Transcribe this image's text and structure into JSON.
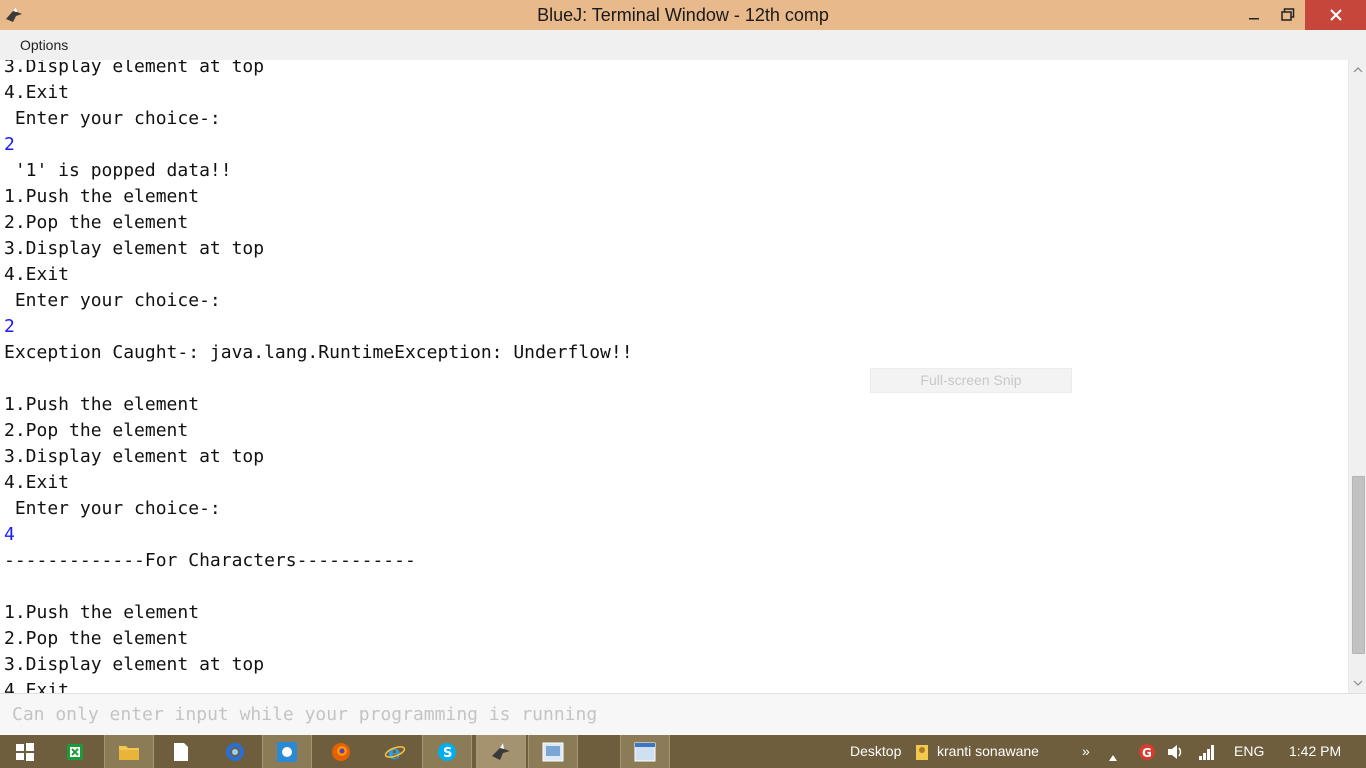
{
  "window": {
    "title": "BlueJ: Terminal Window - 12th comp"
  },
  "menu": {
    "items": [
      "Options"
    ]
  },
  "terminal": {
    "lines": [
      {
        "text": "3.Display element at top",
        "type": "output"
      },
      {
        "text": "4.Exit",
        "type": "output"
      },
      {
        "text": " Enter your choice-:",
        "type": "output"
      },
      {
        "text": "2",
        "type": "input"
      },
      {
        "text": " '1' is popped data!!",
        "type": "output"
      },
      {
        "text": "1.Push the element",
        "type": "output"
      },
      {
        "text": "2.Pop the element",
        "type": "output"
      },
      {
        "text": "3.Display element at top",
        "type": "output"
      },
      {
        "text": "4.Exit",
        "type": "output"
      },
      {
        "text": " Enter your choice-:",
        "type": "output"
      },
      {
        "text": "2",
        "type": "input"
      },
      {
        "text": "Exception Caught-: java.lang.RuntimeException: Underflow!!",
        "type": "output"
      },
      {
        "text": "",
        "type": "output"
      },
      {
        "text": "1.Push the element",
        "type": "output"
      },
      {
        "text": "2.Pop the element",
        "type": "output"
      },
      {
        "text": "3.Display element at top",
        "type": "output"
      },
      {
        "text": "4.Exit",
        "type": "output"
      },
      {
        "text": " Enter your choice-:",
        "type": "output"
      },
      {
        "text": "4",
        "type": "input"
      },
      {
        "text": "-------------For Characters-----------",
        "type": "output"
      },
      {
        "text": "",
        "type": "output"
      },
      {
        "text": "1.Push the element",
        "type": "output"
      },
      {
        "text": "2.Pop the element",
        "type": "output"
      },
      {
        "text": "3.Display element at top",
        "type": "output"
      },
      {
        "text": "4.Exit",
        "type": "output"
      }
    ],
    "input_color": "#1a1aff"
  },
  "snip_overlay": {
    "label": "Full-screen Snip"
  },
  "input_field": {
    "placeholder": "Can only enter input while your programming is running"
  },
  "taskbar": {
    "buttons": [
      {
        "name": "start-button",
        "icon": "windows-logo-icon"
      },
      {
        "name": "excel-button",
        "icon": "spreadsheet-icon"
      },
      {
        "name": "file-explorer-button",
        "icon": "folder-icon"
      },
      {
        "name": "document-button",
        "icon": "document-icon"
      },
      {
        "name": "chrome-button",
        "icon": "browser-icon"
      },
      {
        "name": "weather-button",
        "icon": "sun-icon"
      },
      {
        "name": "firefox-button",
        "icon": "firefox-icon"
      },
      {
        "name": "ie-button",
        "icon": "internet-explorer-icon"
      },
      {
        "name": "skype-button",
        "icon": "skype-icon"
      },
      {
        "name": "bluej-button",
        "icon": "bluej-bird-icon"
      },
      {
        "name": "image-app-button",
        "icon": "picture-icon"
      },
      {
        "name": "window-app-button",
        "icon": "window-icon"
      }
    ],
    "desktop_label": "Desktop",
    "user_label": "kranti sonawane",
    "language": "ENG",
    "time": "1:42 PM"
  }
}
